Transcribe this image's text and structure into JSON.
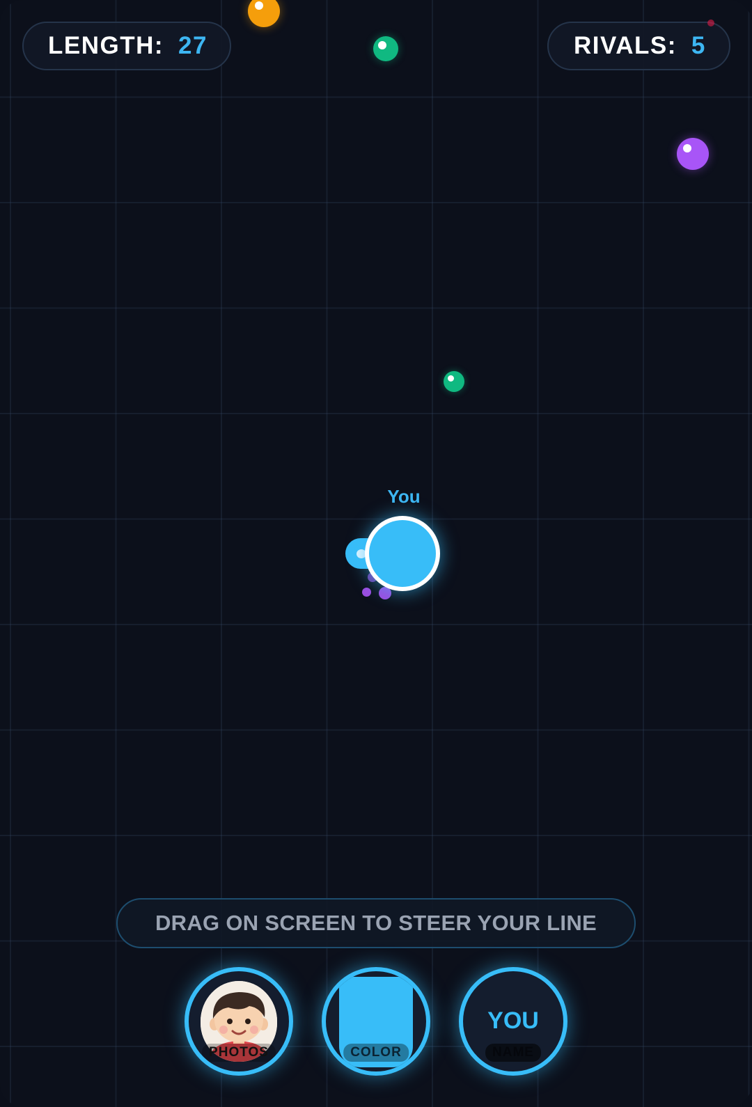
{
  "hud": {
    "length_label": "LENGTH:",
    "length_value": "27",
    "rivals_label": "RIVALS:",
    "rivals_value": "5"
  },
  "player": {
    "name": "You",
    "color": "#38bdf8"
  },
  "food_colors": [
    "#f59e0b",
    "#10b981",
    "#a855f7",
    "#10b981"
  ],
  "hint": "DRAG ON SCREEN TO STEER YOUR LINE",
  "controls": {
    "photos_label": "PHOTOS",
    "color_label": "COLOR",
    "name_value": "YOU",
    "name_label": "NAME"
  },
  "colors": {
    "accent": "#38bdf8",
    "background": "#0c101b"
  }
}
